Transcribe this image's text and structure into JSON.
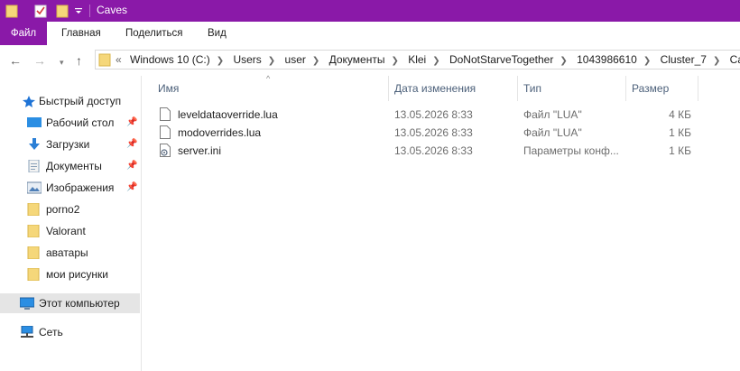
{
  "window": {
    "title": "Caves"
  },
  "ribbon": {
    "tabs": [
      "Файл",
      "Главная",
      "Поделиться",
      "Вид"
    ]
  },
  "address": {
    "overflow": "«",
    "crumbs": [
      "Windows 10 (C:)",
      "Users",
      "user",
      "Документы",
      "Klei",
      "DoNotStarveTogether",
      "1043986610",
      "Cluster_7",
      "Caves"
    ]
  },
  "sidebar": {
    "items": [
      {
        "label": "Быстрый доступ",
        "icon": "star-icon",
        "pinned": false
      },
      {
        "label": "Рабочий стол",
        "icon": "desktop-icon",
        "pinned": true
      },
      {
        "label": "Загрузки",
        "icon": "download-icon",
        "pinned": true
      },
      {
        "label": "Документы",
        "icon": "documents-icon",
        "pinned": true
      },
      {
        "label": "Изображения",
        "icon": "pictures-icon",
        "pinned": true
      },
      {
        "label": "porno2",
        "icon": "folder-icon",
        "pinned": false
      },
      {
        "label": "Valorant",
        "icon": "folder-icon",
        "pinned": false
      },
      {
        "label": "аватары",
        "icon": "folder-icon",
        "pinned": false
      },
      {
        "label": "мои рисунки",
        "icon": "folder-icon",
        "pinned": false
      },
      {
        "label": "Этот компьютер",
        "icon": "computer-icon",
        "pinned": false
      },
      {
        "label": "Сеть",
        "icon": "network-icon",
        "pinned": false
      }
    ]
  },
  "columns": {
    "name": "Имя",
    "date": "Дата изменения",
    "type": "Тип",
    "size": "Размер"
  },
  "files": [
    {
      "name": "leveldataoverride.lua",
      "date": "13.05.2026 8:33",
      "type": "Файл \"LUA\"",
      "size": "4 КБ",
      "icon": "file-icon"
    },
    {
      "name": "modoverrides.lua",
      "date": "13.05.2026 8:33",
      "type": "Файл \"LUA\"",
      "size": "1 КБ",
      "icon": "file-icon"
    },
    {
      "name": "server.ini",
      "date": "13.05.2026 8:33",
      "type": "Параметры конф...",
      "size": "1 КБ",
      "icon": "settings-file-icon"
    }
  ]
}
